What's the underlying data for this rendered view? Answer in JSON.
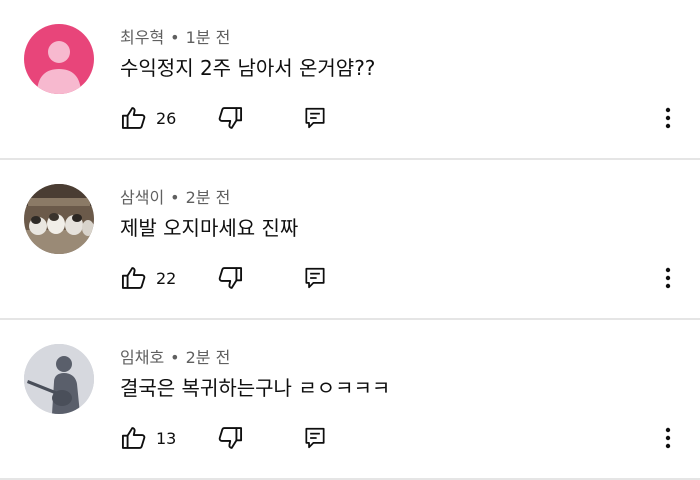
{
  "comments": [
    {
      "author": "최우혁",
      "time": "1분 전",
      "text": "수익정지 2주 남아서 온거얌??",
      "likes": "26",
      "avatar": "pink-default-avatar",
      "avatar_color": "#e8457a"
    },
    {
      "author": "삼색이",
      "time": "2분 전",
      "text": "제발 오지마세요 진짜",
      "likes": "22",
      "avatar": "cats-photo-avatar"
    },
    {
      "author": "임채호",
      "time": "2분 전",
      "text": "결국은 복귀하는구나 ㄹㅇㅋㅋㅋ",
      "likes": "13",
      "avatar": "guitar-silhouette-avatar"
    }
  ],
  "separator": "•",
  "icons": {
    "like": "thumbs-up-icon",
    "dislike": "thumbs-down-icon",
    "reply": "reply-icon",
    "more": "more-vertical-icon"
  }
}
